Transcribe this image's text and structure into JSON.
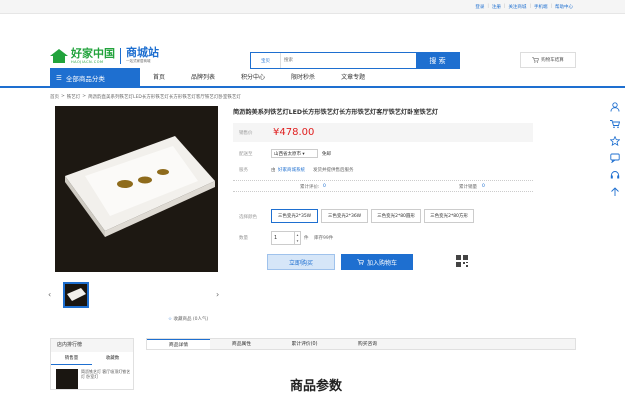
{
  "topbar": {
    "links": [
      "登录",
      "注册",
      "关注商城",
      "手机端",
      "帮助中心"
    ]
  },
  "logo": {
    "main": "好家中国",
    "sub": "HAOJIACN.COM",
    "site": "商城站",
    "site_sub": "一站式家居商城"
  },
  "search": {
    "category": "宝贝",
    "placeholder": "搜索",
    "button": "搜 索"
  },
  "cart": {
    "label": "购物车结算"
  },
  "nav": {
    "all_categories": "全部商品分类",
    "items": [
      "首页",
      "品牌列表",
      "积分中心",
      "限时秒杀",
      "文章专题"
    ]
  },
  "breadcrumb": [
    "首页",
    "铁艺灯",
    "简沥韵直美系列铁艺灯LED长方形铁艺灯长方形铁艺灯客厅铁艺灯卧室铁艺灯"
  ],
  "product": {
    "title": "简沥韵美系列铁艺灯LED长方形铁艺灯长方形铁艺灯客厅铁艺灯卧室铁艺灯",
    "price_label": "销售价",
    "price": "¥478.00",
    "ship_label": "配送至",
    "ship_to": "山西省太原市 ▾",
    "ship_note": "免邮",
    "service_label": "服务",
    "service_from": "由",
    "service_shop": "好家商城系统",
    "service_tail": "发货并提供售后服务",
    "reviews_label": "累计评价:",
    "reviews": "0",
    "sales_label": "累计销量",
    "sales": "0",
    "color_label": "选择颜色",
    "options": [
      "三色变光2*35W",
      "三色变光2*36W",
      "三色变光2*80圆形",
      "三色变光2*80方形"
    ],
    "qty_label": "数量",
    "qty": "1",
    "qty_unit": "件",
    "stock": "库存99件",
    "buy_now": "立即购买",
    "add_cart": "加入购物车",
    "favorite": "收藏商品 (0人气)"
  },
  "rank": {
    "title": "店内排行榜",
    "tabs": [
      "销售量",
      "收藏数"
    ],
    "item_text": "简沥铁艺灯 客厅吸顶灯铁艺灯 卧室灯"
  },
  "detail_tabs": [
    "商品详情",
    "商品属性",
    "累计评价(0)",
    "购买咨询"
  ],
  "spec_title": "商品参数",
  "colors": {
    "accent": "#1e6fd0",
    "brand_green": "#22a33c",
    "price": "#e02020"
  }
}
